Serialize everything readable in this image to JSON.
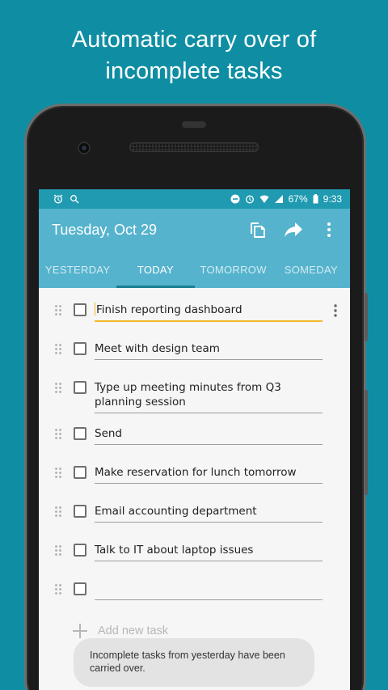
{
  "headline": {
    "line1": "Automatic carry over of",
    "line2": "incomplete tasks"
  },
  "status_bar": {
    "left_icons": [
      "alarm-icon",
      "no-sim-icon"
    ],
    "right_icons": [
      "do-not-disturb-icon",
      "alarm-icon",
      "wifi-icon",
      "signal-icon"
    ],
    "battery": "67%",
    "time": "9:33"
  },
  "app_bar": {
    "title": "Tuesday, Oct 29",
    "actions": [
      "copy-icon",
      "share-icon",
      "overflow-menu-icon"
    ]
  },
  "tabs": [
    {
      "label": "YESTERDAY",
      "active": false
    },
    {
      "label": "TODAY",
      "active": true
    },
    {
      "label": "TOMORROW",
      "active": false
    },
    {
      "label": "SOMEDAY",
      "active": false
    }
  ],
  "tasks": [
    {
      "text": "Finish reporting dashboard",
      "checked": false,
      "editing": true
    },
    {
      "text": "Meet with design team",
      "checked": false
    },
    {
      "text": "Type up meeting minutes from Q3 planning session",
      "checked": false
    },
    {
      "text": "Send",
      "checked": false
    },
    {
      "text": "Make reservation for lunch tomorrow",
      "checked": false
    },
    {
      "text": "Email accounting department",
      "checked": false
    },
    {
      "text": "Talk to IT about laptop issues",
      "checked": false
    },
    {
      "text": "",
      "checked": false
    }
  ],
  "add_task": {
    "label": "Add new task"
  },
  "toast": {
    "message": "Incomplete tasks from yesterday have been carried over."
  },
  "colors": {
    "background": "#0f8ea3",
    "app_bar": "#55b3cd",
    "status_bar": "#1f9ab0",
    "tab_indicator": "#1b7f93",
    "edit_underline": "#f2b82a"
  }
}
